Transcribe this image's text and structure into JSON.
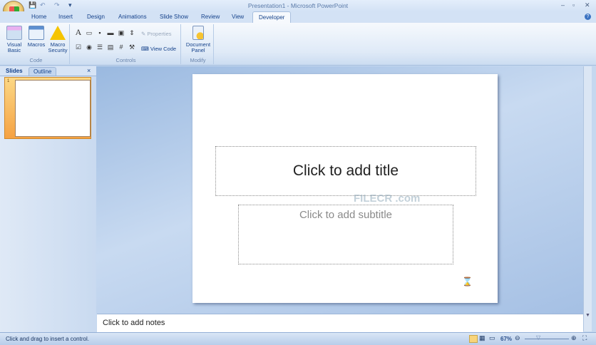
{
  "window": {
    "title": "Presentation1 - Microsoft PowerPoint",
    "minimize_icon": "minimize-icon",
    "maximize_icon": "restore-icon",
    "close_icon": "close-icon"
  },
  "quick_access": {
    "save": "save-icon",
    "undo": "undo-icon",
    "redo": "redo-icon",
    "customize": "▾"
  },
  "tabs": [
    "Home",
    "Insert",
    "Design",
    "Animations",
    "Slide Show",
    "Review",
    "View",
    "Developer"
  ],
  "active_tab": "Developer",
  "ribbon": {
    "code": {
      "label": "Code",
      "visual_basic": "Visual Basic",
      "macros": "Macros",
      "macro_security": "Macro Security"
    },
    "controls": {
      "label": "Controls",
      "properties": "Properties",
      "view_code": "View Code"
    },
    "modify": {
      "label": "Modify",
      "document_panel": "Document Panel"
    }
  },
  "left_pane": {
    "tabs": [
      "Slides",
      "Outline"
    ],
    "close": "×",
    "slide_number": "1"
  },
  "slide": {
    "title_placeholder": "Click to add title",
    "subtitle_placeholder": "Click to add subtitle",
    "watermark": "FILECR .com"
  },
  "notes": {
    "placeholder": "Click to add notes"
  },
  "status": {
    "message": "Click and drag to insert a control.",
    "zoom": "67%"
  }
}
